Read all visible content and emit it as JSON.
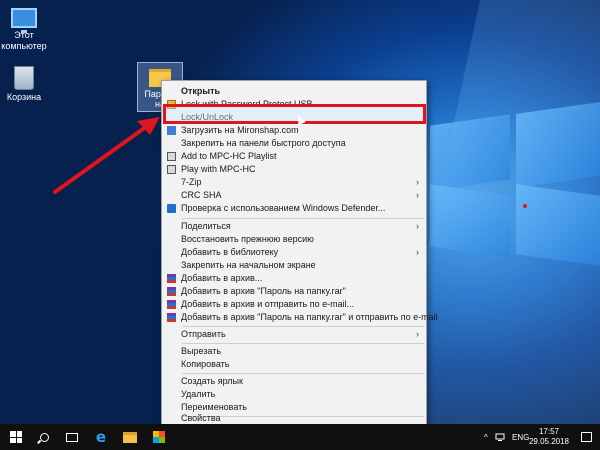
{
  "desktop": {
    "icons": [
      {
        "label_line1": "Этот",
        "label_line2": "компьютер",
        "icon": "computer-icon"
      },
      {
        "label_line1": "Корзина",
        "icon": "recycle-bin-icon"
      },
      {
        "label_line1": "Пароль",
        "label_line2": "на",
        "icon": "folder-icon"
      }
    ]
  },
  "context_menu": {
    "items": [
      {
        "label": "Открыть",
        "bold": true
      },
      {
        "label": "Lock with Password Protect USB",
        "icon": "lock-icon"
      },
      {
        "label": "Lock/UnLock",
        "highlighted": true
      },
      {
        "label": "Загрузить на Mironshap.com",
        "icon": "upload-icon"
      },
      {
        "label": "Закрепить на панели быстрого доступа"
      },
      {
        "label": "Add to MPC-HC Playlist",
        "icon": "mpc-icon"
      },
      {
        "label": "Play with MPC-HC",
        "icon": "mpc-icon"
      },
      {
        "label": "7-Zip",
        "submenu": true
      },
      {
        "label": "CRC SHA",
        "submenu": true
      },
      {
        "label": "Проверка с использованием Windows Defender...",
        "icon": "defender-shield-icon"
      },
      {
        "label": "Поделиться",
        "submenu": true
      },
      {
        "label": "Восстановить прежнюю версию"
      },
      {
        "label": "Добавить в библиотеку",
        "submenu": true
      },
      {
        "label": "Закрепить на начальном экране"
      },
      {
        "label": "Добавить в архив...",
        "icon": "winrar-icon"
      },
      {
        "label": "Добавить в архив \"Пароль на папку.rar\"",
        "icon": "winrar-icon"
      },
      {
        "label": "Добавить в архив и отправить по e-mail...",
        "icon": "winrar-icon"
      },
      {
        "label": "Добавить в архив \"Пароль на папку.rar\" и отправить по e-mail",
        "icon": "winrar-icon"
      },
      {
        "label": "Отправить",
        "submenu": true
      },
      {
        "label": "Вырезать"
      },
      {
        "label": "Копировать"
      },
      {
        "label": "Создать ярлык"
      },
      {
        "label": "Удалить"
      },
      {
        "label": "Переименовать"
      },
      {
        "label": "Свойства"
      }
    ],
    "submenu_arrow": "›"
  },
  "taskbar": {
    "start_icon": "windows-start-icon",
    "search_icon": "search-icon",
    "taskview_icon": "task-view-icon",
    "edge_glyph": "e",
    "language": "ENG",
    "time": "17:57",
    "date": "29.05.2018",
    "tray_chevron": "^"
  },
  "colors": {
    "highlight_border": "#e0141e",
    "arrow": "#e0141e",
    "taskbar": "#101010"
  }
}
